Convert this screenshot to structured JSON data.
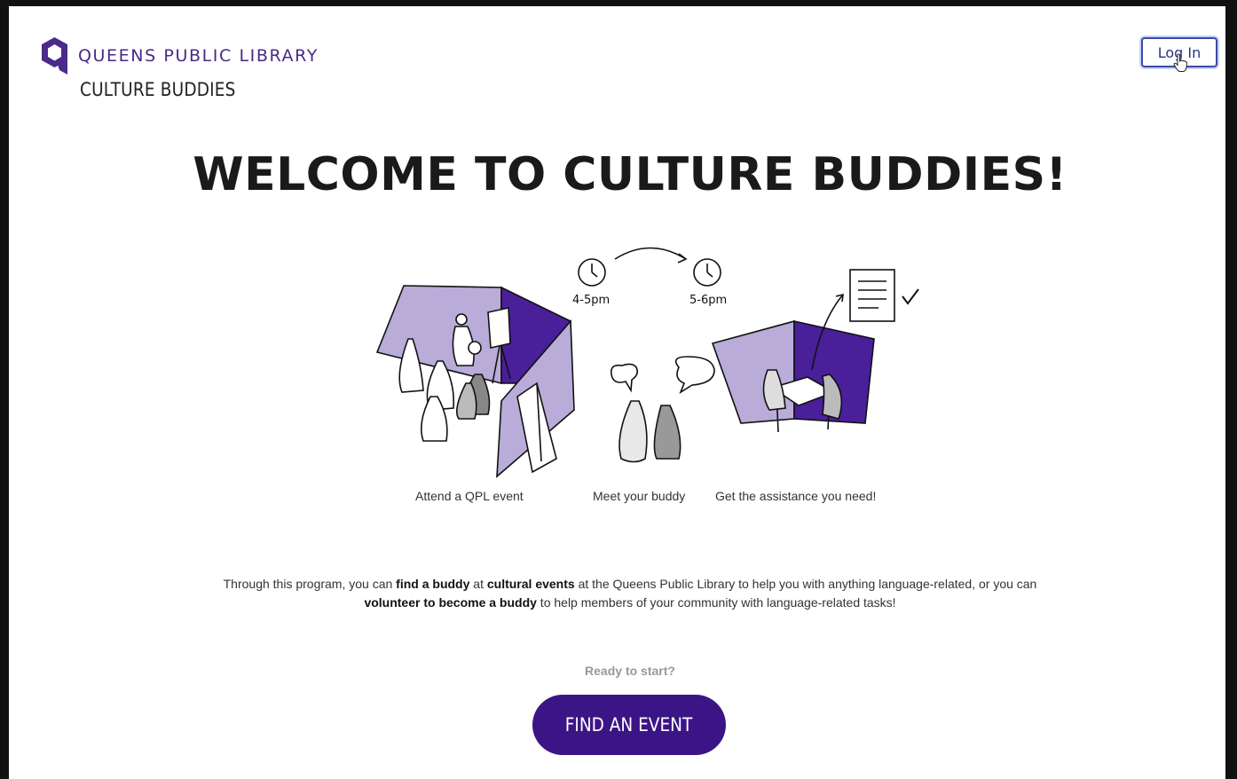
{
  "header": {
    "brand_name": "QUEENS PUBLIC LIBRARY",
    "program_name": "CULTURE BUDDIES",
    "login_label": "Log In"
  },
  "hero": {
    "title": "WELCOME TO CULTURE BUDDIES!"
  },
  "illustration": {
    "time_start": "4-5pm",
    "time_end": "5-6pm"
  },
  "steps": [
    {
      "label": "Attend a QPL event"
    },
    {
      "label": "Meet your buddy"
    },
    {
      "label": "Get the assistance you need!"
    }
  ],
  "description": {
    "p1": "Through this program, you can ",
    "b1": "find a buddy",
    "p2": " at ",
    "b2": "cultural events",
    "p3": " at the Queens Public Library to help you with anything language-related, or you can ",
    "b3": "volunteer to become a buddy",
    "p4": " to help members of your community with language-related tasks!"
  },
  "cta": {
    "prompt": "Ready to start?",
    "button_label": "FIND AN EVENT"
  },
  "colors": {
    "brand_purple": "#3b1585",
    "light_purple": "#b9acd9",
    "dark_purple": "#4a1f9a"
  }
}
